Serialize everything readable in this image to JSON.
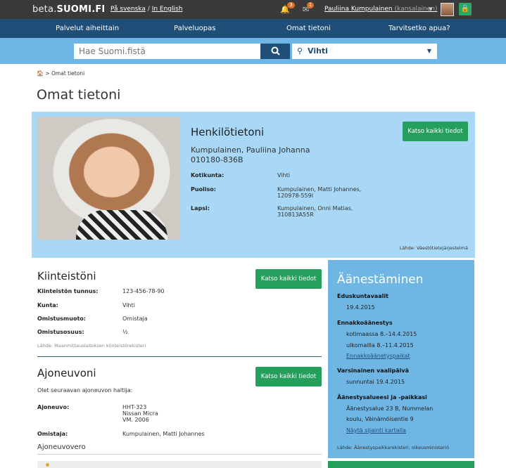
{
  "topbar": {
    "logo_prefix": "beta.",
    "logo_main": "SUOMI.FI",
    "lang_sv": "På svenska",
    "lang_sep": " / ",
    "lang_en": "In English",
    "notif_count": "3",
    "mail_count": "1",
    "user_name": "Pauliina Kumpulainen",
    "user_role": "(kansalainen)"
  },
  "nav": {
    "items": [
      "Palvelut aiheittain",
      "Palveluopas",
      "Omat tietoni",
      "Tarvitsetko apua?"
    ]
  },
  "search": {
    "placeholder": "Hae Suomi.fistä",
    "location": "Vihti"
  },
  "breadcrumb": {
    "current": "Omat tietoni"
  },
  "page_title": "Omat tietoni",
  "person": {
    "title": "Henkilötietoni",
    "name": "Kumpulainen, Pauliina Johanna",
    "id": "010180-836B",
    "button": "Katso kaikki tiedot",
    "fields": [
      {
        "label": "Kotikunta:",
        "value": "Vihti"
      },
      {
        "label": "Puoliso:",
        "value1": "Kumpulainen, Matti Johannes,",
        "value2": "120978-559l"
      },
      {
        "label": "Lapsi:",
        "value1": "Kumpulainen, Onni Matias,",
        "value2": "310813A55R"
      }
    ],
    "source": "Lähde: Väestötietojärjestelmä"
  },
  "property": {
    "title": "Kiinteistöni",
    "button": "Katso kaikki tiedot",
    "rows": [
      {
        "label": "Kiinteistön tunnus:",
        "value": "123-456-78-90"
      },
      {
        "label": "Kunta:",
        "value": "Vihti"
      },
      {
        "label": "Omistusmuoto:",
        "value": "Omistaja"
      },
      {
        "label": "Omistusosuus:",
        "value": "½"
      }
    ],
    "source": "Lähde: Maanmittauslaitoksen kiinteistörekisteri"
  },
  "vehicles": {
    "title": "Ajoneuvoni",
    "button": "Katso kaikki tiedot",
    "intro": "Olet seuraavan ajoneuvon haltija:",
    "vehicle_label": "Ajoneuvo:",
    "vehicle_lines": [
      "HHT-323",
      "Nissan Micra",
      "VM. 2006"
    ],
    "owner_label": "Omistaja:",
    "owner_value": "Kumpulainen, Matti Johannes",
    "tax_title": "Ajoneuvovero"
  },
  "voting": {
    "title": "Äänestäminen",
    "election": "Eduskuntavaalit",
    "election_date": "19.4.2015",
    "advance": "Ennakkoäänestys",
    "advance_home": "kotimaassa 8.–14.4.2015",
    "advance_abroad": "ulkomailla 8.–11.4.2015",
    "advance_link": "Ennakkoäänetyspaikat",
    "main_day": "Varsinainen vaalipäivä",
    "main_day_value": "sunnuntai 19.4.2015",
    "place": "Äänestysalueesi ja -paikkasi",
    "place_line1": "Äänestysalue 23 B, Nummelan",
    "place_line2": "koulu, Väinämöisentie 9",
    "place_link": "Näytä sijainti kartalla",
    "source": "Lähde: Äänestyspaikkarekisteri, oikeusministeriö"
  }
}
